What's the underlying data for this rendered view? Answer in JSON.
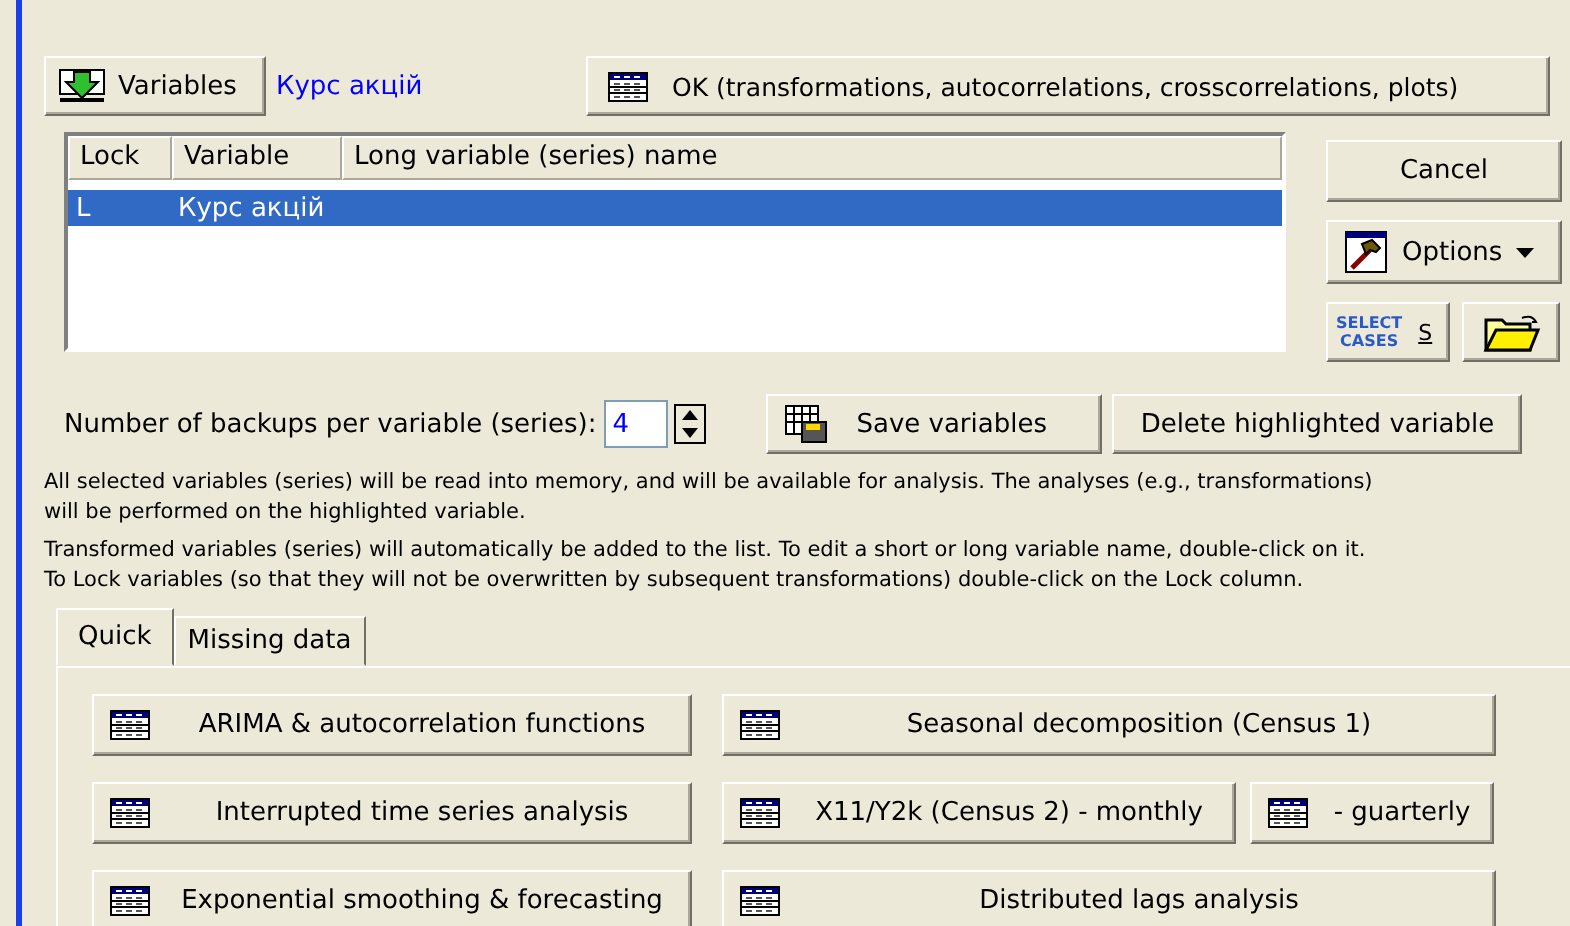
{
  "variables_button": "Variables",
  "selected_variables": "Курс акцій",
  "ok_button": "OK (transformations, autocorrelations, crosscorrelations, plots)",
  "variable_list": {
    "columns": [
      "Lock",
      "Variable",
      "Long variable (series) name"
    ],
    "rows": [
      {
        "lock": "L",
        "variable": "Курс акцій",
        "long_name": "",
        "selected": true
      }
    ]
  },
  "cancel_button": "Cancel",
  "options_button": "Options",
  "select_cases_button": {
    "label_top": "SELECT",
    "label_bottom": "CASES",
    "marker": "S"
  },
  "backups": {
    "label": "Number of backups per variable (series):",
    "value": "4"
  },
  "save_button": "Save variables",
  "delete_button": "Delete highlighted variable",
  "notes": [
    "All selected variables (series) will be read into memory, and will be available for analysis. The analyses (e.g., transformations)",
    "will be performed on the highlighted variable.",
    "Transformed variables (series) will automatically be added to the list. To edit a short or long variable name, double-click on it.",
    "To Lock variables (so that they will not be overwritten by subsequent transformations) double-click on the Lock column."
  ],
  "tabs": [
    {
      "label": "Quick",
      "selected": true
    },
    {
      "label": "Missing data",
      "selected": false
    }
  ],
  "analyses": [
    {
      "label": "ARIMA & autocorrelation functions",
      "kind": "wide"
    },
    {
      "label": "Seasonal decomposition (Census 1)",
      "kind": "wide"
    },
    {
      "label": "Interrupted time series analysis",
      "kind": "wide"
    },
    {
      "label": "X11/Y2k (Census 2) - monthly",
      "kind": "split"
    },
    {
      "label": "- guarterly",
      "kind": "small"
    },
    {
      "label": "Exponential smoothing & forecasting",
      "kind": "wide"
    },
    {
      "label": "Distributed lags analysis",
      "kind": "wide"
    }
  ]
}
